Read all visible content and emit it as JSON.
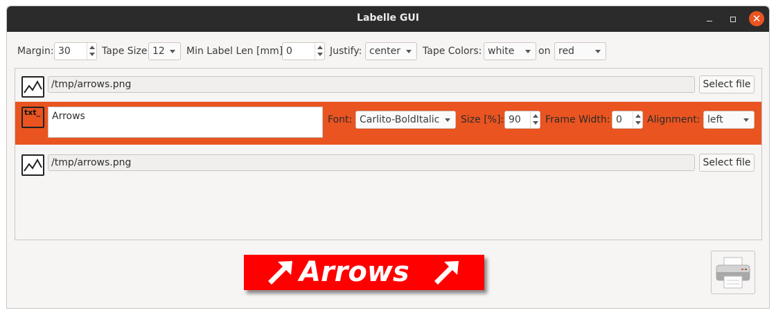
{
  "window": {
    "title": "Labelle GUI"
  },
  "settings": {
    "margin_label": "Margin:",
    "margin_value": "30",
    "tape_size_label": "Tape Size:",
    "tape_size_value": "12",
    "min_len_label": "Min Label Len [mm]:",
    "min_len_value": "0",
    "justify_label": "Justify:",
    "justify_value": "center",
    "tape_colors_label": "Tape Colors:",
    "tape_color_fg": "white",
    "on_label": "on",
    "tape_color_bg": "red"
  },
  "rows": {
    "image1": {
      "path": "/tmp/arrows.png",
      "button": "Select file"
    },
    "text": {
      "icon_text": "txt_",
      "content": "Arrows",
      "font_label": "Font:",
      "font_value": "Carlito-BoldItalic",
      "size_label": "Size [%]:",
      "size_value": "90",
      "frame_label": "Frame Width:",
      "frame_value": "0",
      "align_label": "Alignment:",
      "align_value": "left"
    },
    "image2": {
      "path": "/tmp/arrows.png",
      "button": "Select file"
    }
  },
  "preview": {
    "text": "Arrows"
  },
  "colors": {
    "accent": "#e95420",
    "preview_bg": "#ff0000",
    "preview_fg": "#ffffff"
  },
  "icons": [
    "image-icon",
    "text-icon",
    "printer-icon",
    "arrow-up-right-icon",
    "close-icon",
    "minimize-icon",
    "maximize-icon"
  ]
}
